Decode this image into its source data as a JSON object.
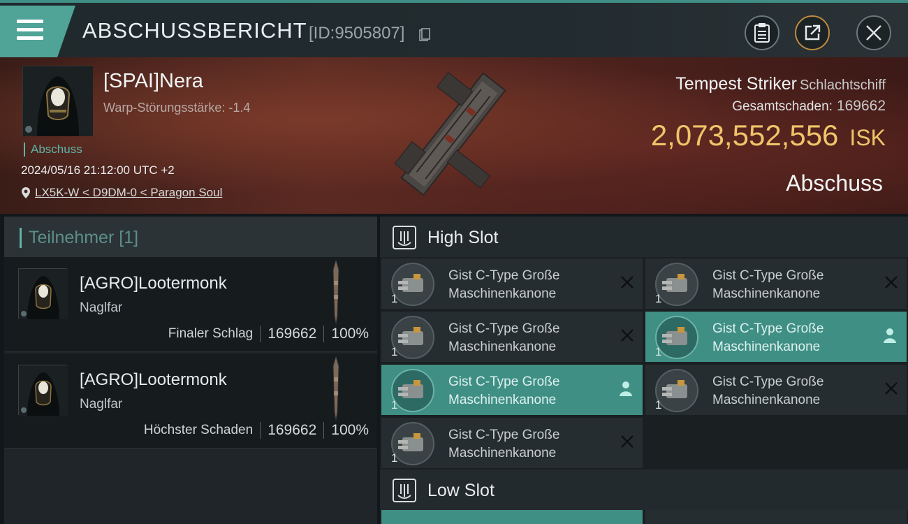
{
  "header": {
    "title": "ABSCHUSSBERICHT",
    "kill_id": "[ID:9505807]",
    "menu_icon": "hamburger-icon",
    "buttons": [
      {
        "name": "clipboard",
        "icon": "clipboard-icon"
      },
      {
        "name": "share",
        "icon": "share-icon"
      },
      {
        "name": "close",
        "icon": "close-icon"
      }
    ]
  },
  "victim": {
    "name": "[SPAI]Nera",
    "warp": "Warp-Störungsstärke: -1.4",
    "kill_tag": "Abschuss",
    "datetime": "2024/05/16 21:12:00 UTC +2",
    "location": "LX5K-W < D9DM-0 < Paragon Soul"
  },
  "ship": {
    "name": "Tempest Striker",
    "class": "Schlachtschiff",
    "damage_label": "Gesamtschaden:",
    "damage_value": "169662",
    "isk_value": "2,073,552,556",
    "isk_unit": "ISK",
    "kill_type": "Abschuss"
  },
  "participants": {
    "header_label": "Teilnehmer",
    "count": "[1]",
    "rows": [
      {
        "name": "[AGRO]Lootermonk",
        "ship": "Naglfar",
        "label": "Finaler Schlag",
        "damage": "169662",
        "percent": "100%"
      },
      {
        "name": "[AGRO]Lootermonk",
        "ship": "Naglfar",
        "label": "Höchster Schaden",
        "damage": "169662",
        "percent": "100%"
      }
    ]
  },
  "slots": {
    "high_label": "High Slot",
    "low_label": "Low Slot",
    "modules": [
      {
        "line1": "Gist C-Type Große",
        "line2": "Maschinenkanone",
        "qty": "1",
        "state": "destroyed",
        "selected": false
      },
      {
        "line1": "Gist C-Type Große",
        "line2": "Maschinenkanone",
        "qty": "1",
        "state": "destroyed",
        "selected": false
      },
      {
        "line1": "Gist C-Type Große",
        "line2": "Maschinenkanone",
        "qty": "1",
        "state": "destroyed",
        "selected": false
      },
      {
        "line1": "Gist C-Type Große",
        "line2": "Maschinenkanone",
        "qty": "1",
        "state": "dropped",
        "selected": true
      },
      {
        "line1": "Gist C-Type Große",
        "line2": "Maschinenkanone",
        "qty": "1",
        "state": "dropped",
        "selected": true
      },
      {
        "line1": "Gist C-Type Große",
        "line2": "Maschinenkanone",
        "qty": "1",
        "state": "destroyed",
        "selected": false
      },
      {
        "line1": "Gist C-Type Große",
        "line2": "Maschinenkanone",
        "qty": "1",
        "state": "destroyed",
        "selected": false
      }
    ]
  },
  "colors": {
    "accent": "#4fa497",
    "isk_gold": "#f0c46a",
    "panel_dark": "#161b1e"
  }
}
